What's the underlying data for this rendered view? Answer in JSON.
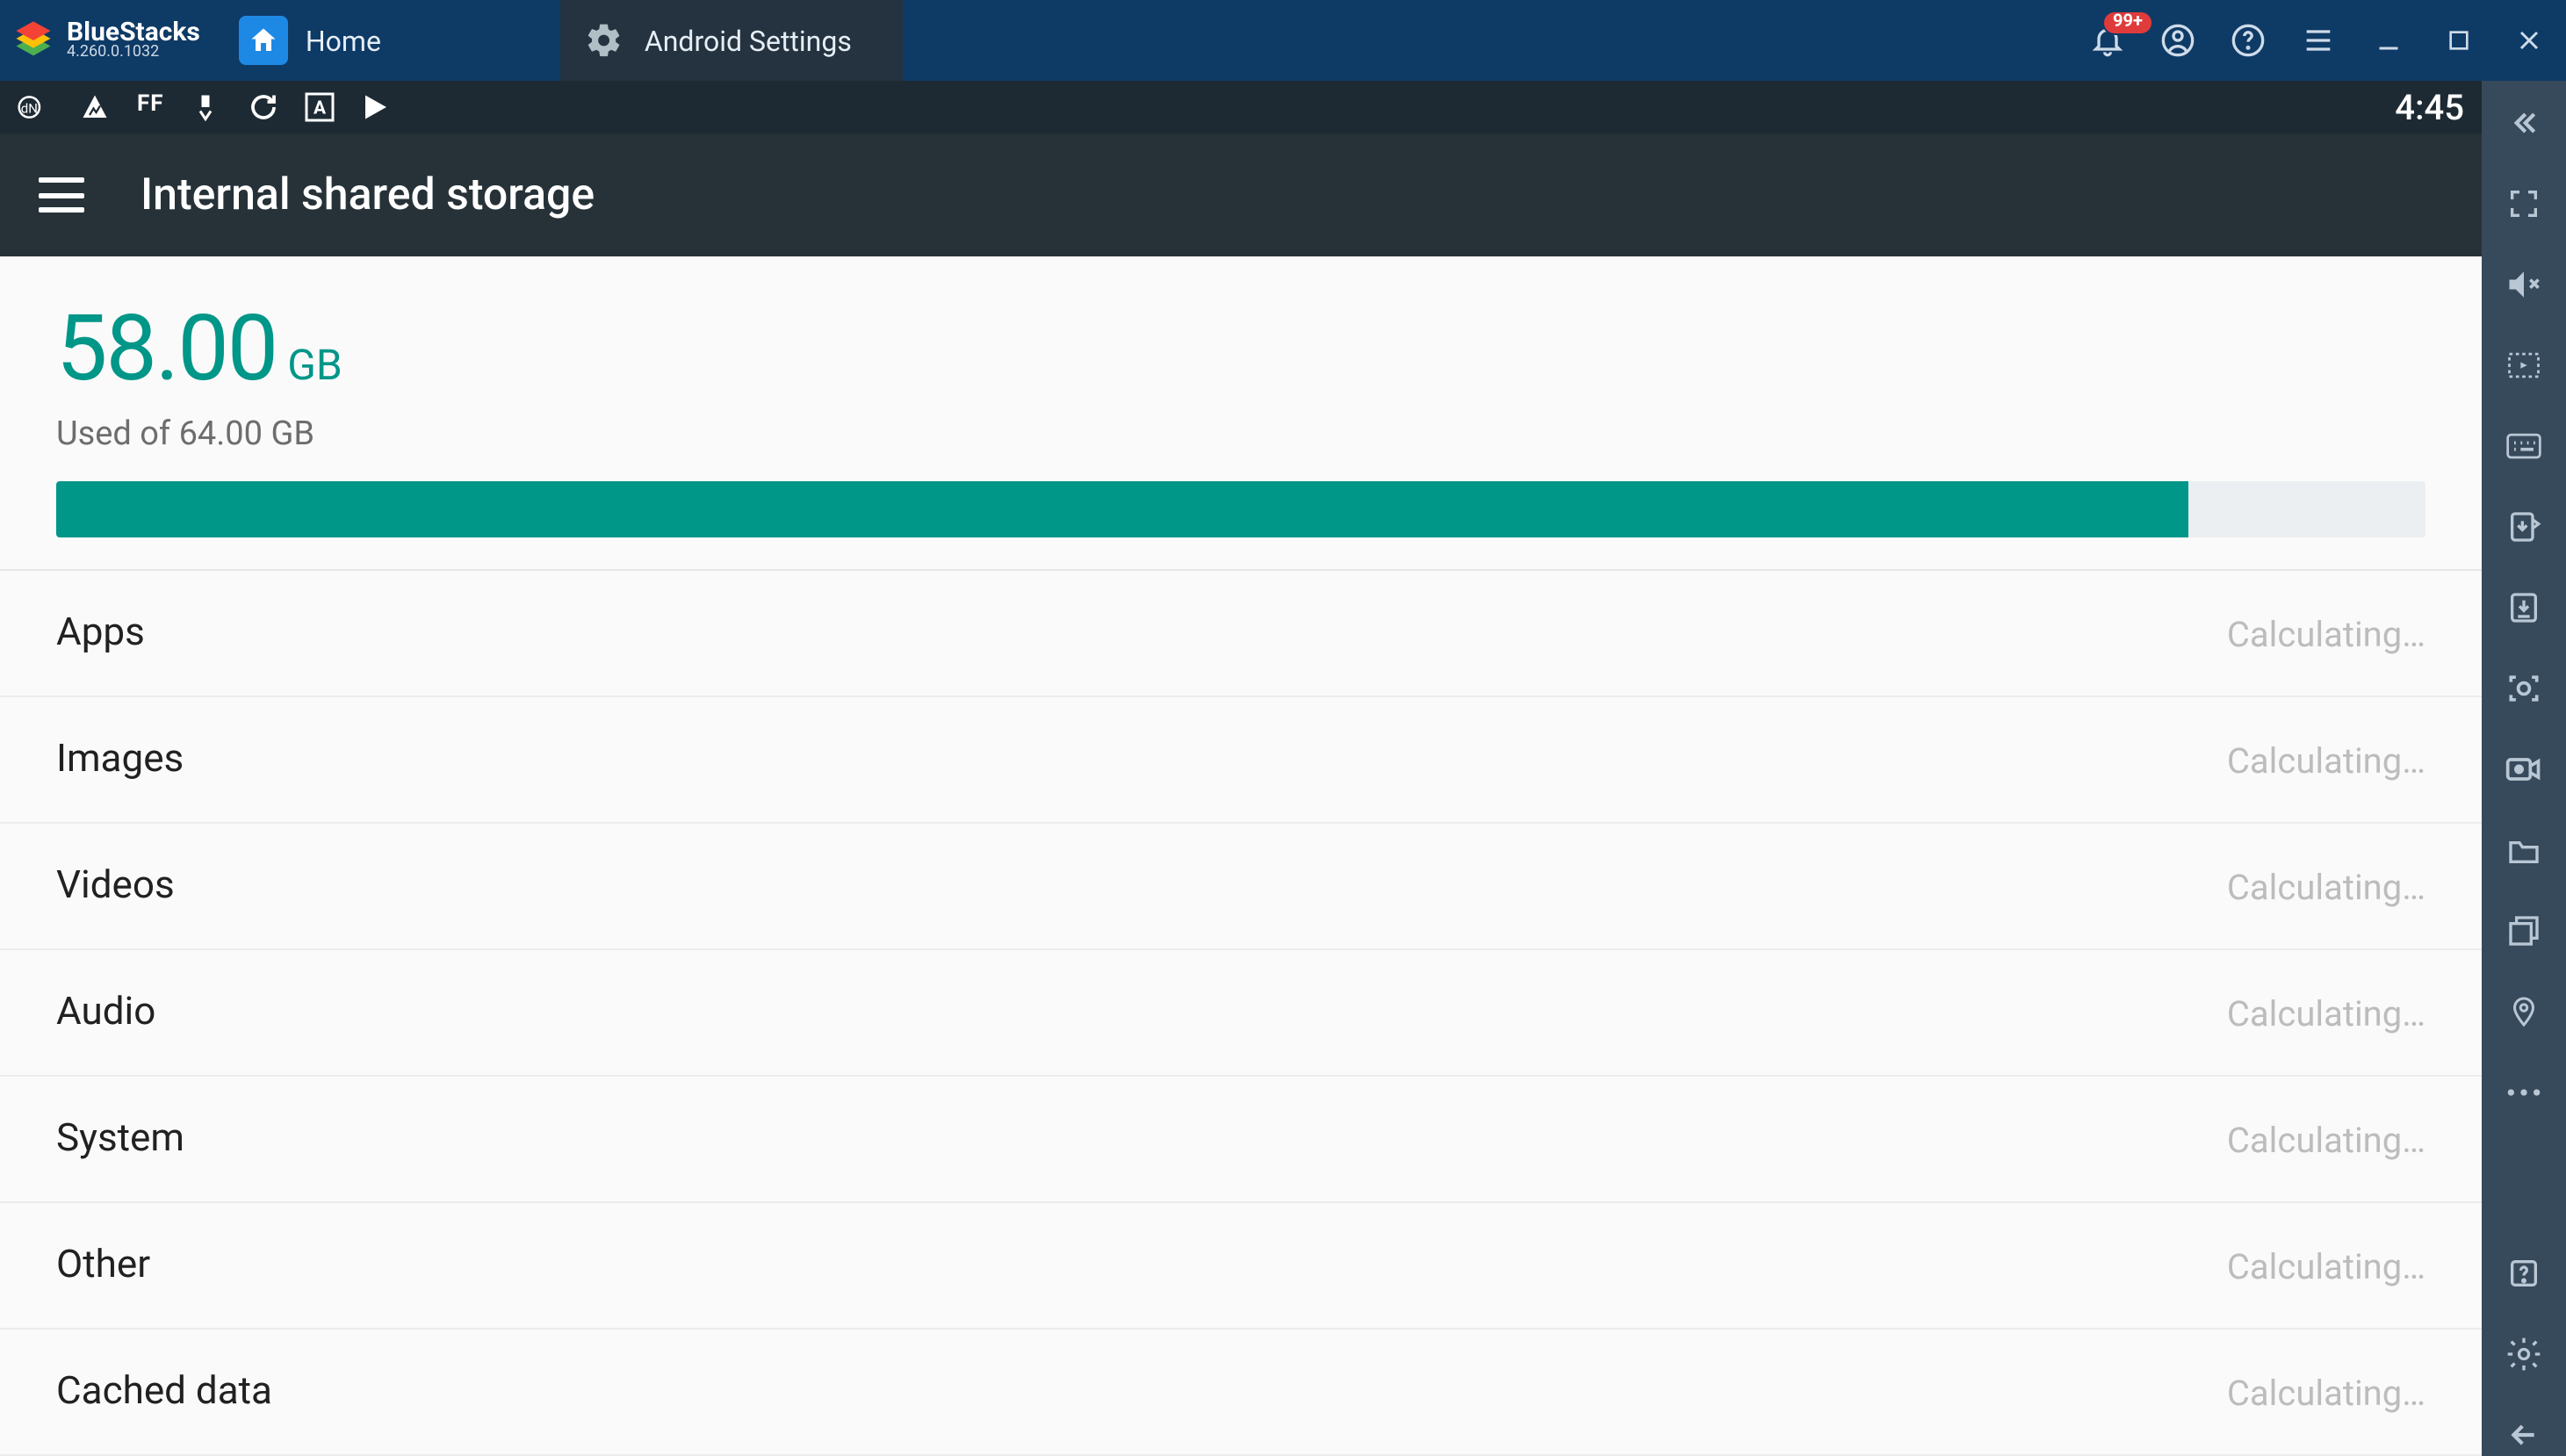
{
  "app": {
    "name": "BlueStacks",
    "version": "4.260.0.1032"
  },
  "tabs": [
    {
      "label": "Home",
      "icon": "home"
    },
    {
      "label": "Android Settings",
      "icon": "gear"
    }
  ],
  "titleActions": {
    "bellBadge": "99+"
  },
  "statusbar": {
    "clock": "4:45"
  },
  "actionbar": {
    "title": "Internal shared storage"
  },
  "storage": {
    "usedValue": "58.00",
    "usedUnit": "GB",
    "subtitle": "Used of 64.00 GB",
    "progressPercent": 90
  },
  "categories": [
    {
      "label": "Apps",
      "value": "Calculating…"
    },
    {
      "label": "Images",
      "value": "Calculating…"
    },
    {
      "label": "Videos",
      "value": "Calculating…"
    },
    {
      "label": "Audio",
      "value": "Calculating…"
    },
    {
      "label": "System",
      "value": "Calculating…"
    },
    {
      "label": "Other",
      "value": "Calculating…"
    },
    {
      "label": "Cached data",
      "value": "Calculating…"
    }
  ]
}
